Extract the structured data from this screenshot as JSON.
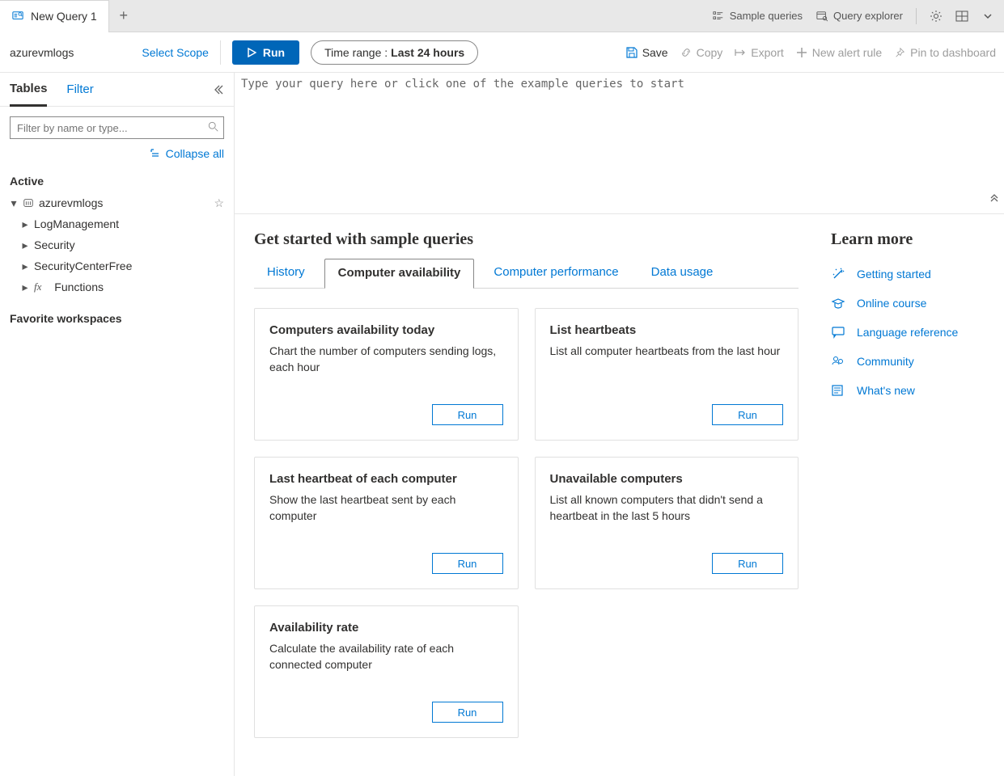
{
  "tabs": {
    "main": "New Query 1"
  },
  "topbar": {
    "sample_queries": "Sample queries",
    "query_explorer": "Query explorer"
  },
  "toolbar": {
    "workspace": "azurevmlogs",
    "select_scope": "Select Scope",
    "run": "Run",
    "timerange_label": "Time range :",
    "timerange_value": "Last 24 hours",
    "save": "Save",
    "copy": "Copy",
    "export": "Export",
    "new_alert": "New alert rule",
    "pin": "Pin to dashboard"
  },
  "sidebar": {
    "tabs": {
      "tables": "Tables",
      "filter": "Filter"
    },
    "search_placeholder": "Filter by name or type...",
    "collapse_all": "Collapse all",
    "active_label": "Active",
    "workspace_name": "azurevmlogs",
    "nodes": [
      {
        "label": "LogManagement"
      },
      {
        "label": "Security"
      },
      {
        "label": "SecurityCenterFree"
      },
      {
        "label": "Functions"
      }
    ],
    "favorite_label": "Favorite workspaces"
  },
  "editor": {
    "placeholder": "Type your query here or click one of the example queries to start"
  },
  "samples": {
    "title": "Get started with sample queries",
    "tabs": [
      {
        "label": "History"
      },
      {
        "label": "Computer availability"
      },
      {
        "label": "Computer performance"
      },
      {
        "label": "Data usage"
      }
    ],
    "active_index": 1,
    "run_label": "Run",
    "cards": [
      {
        "title": "Computers availability today",
        "desc": "Chart the number of computers sending logs, each hour"
      },
      {
        "title": "List heartbeats",
        "desc": "List all computer heartbeats from the last hour"
      },
      {
        "title": "Last heartbeat of each computer",
        "desc": "Show the last heartbeat sent by each computer"
      },
      {
        "title": "Unavailable computers",
        "desc": "List all known computers that didn't send a heartbeat in the last 5 hours"
      },
      {
        "title": "Availability rate",
        "desc": "Calculate the availability rate of each connected computer"
      }
    ]
  },
  "learn": {
    "title": "Learn more",
    "links": [
      {
        "label": "Getting started"
      },
      {
        "label": "Online course"
      },
      {
        "label": "Language reference"
      },
      {
        "label": "Community"
      },
      {
        "label": "What's new"
      }
    ]
  }
}
